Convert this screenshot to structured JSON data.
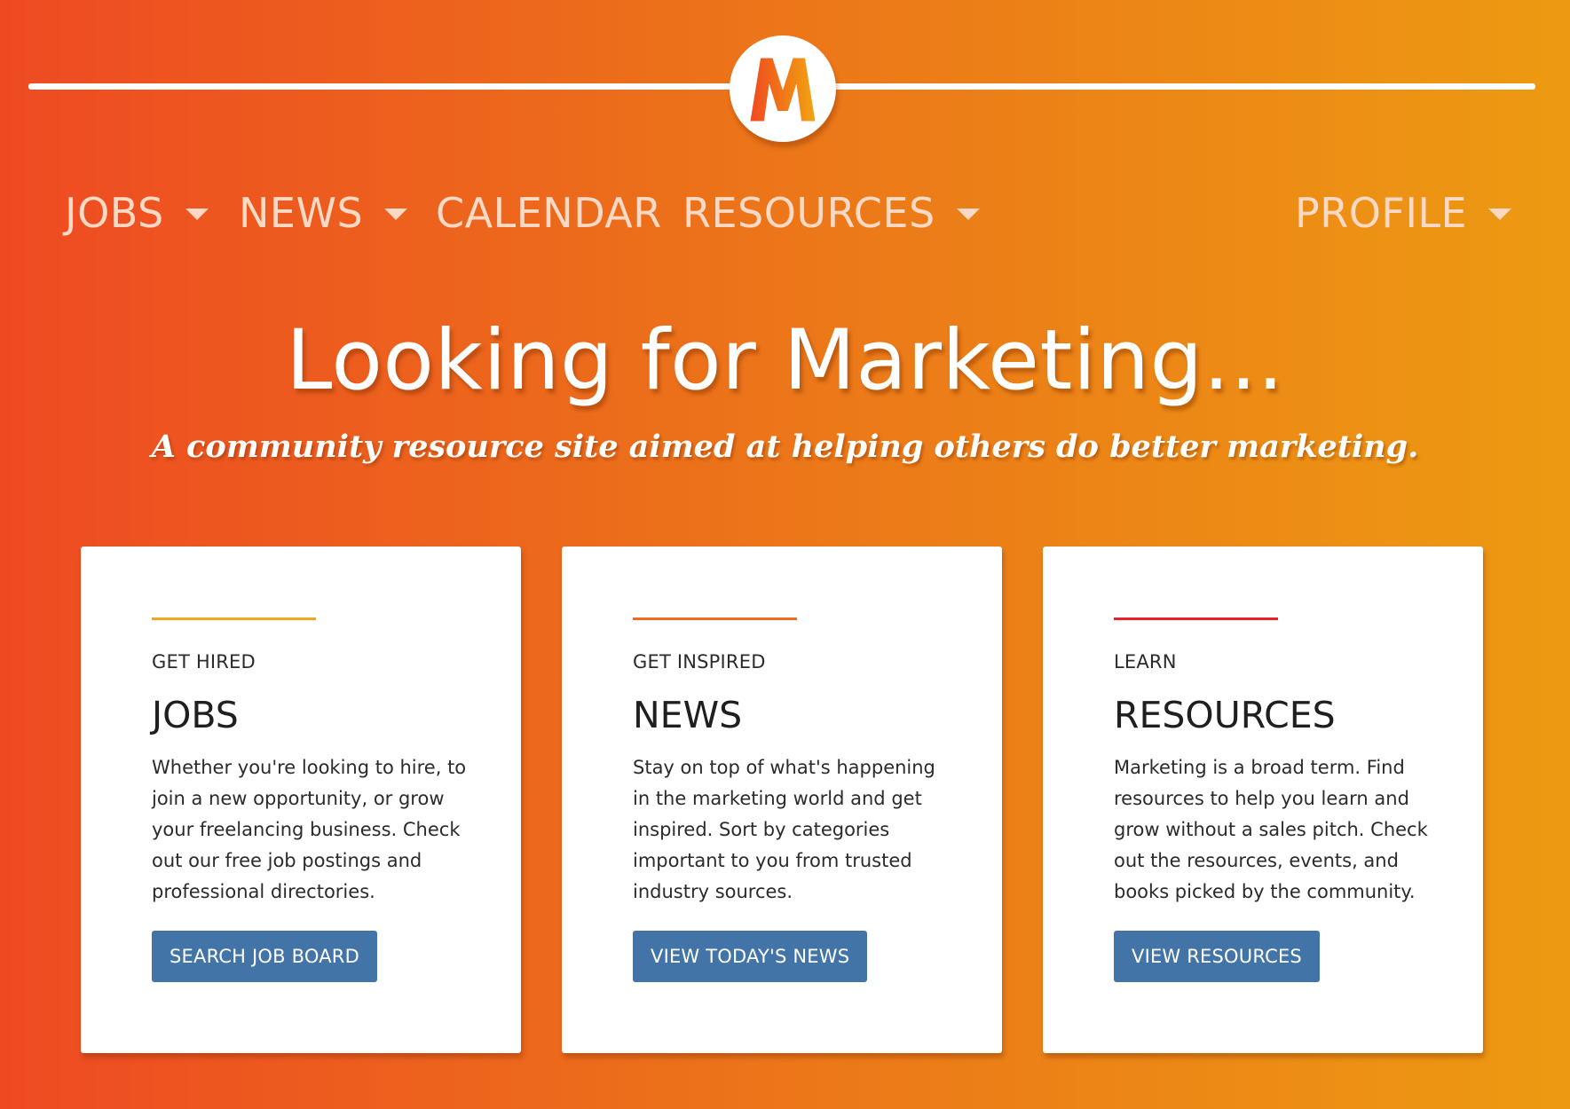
{
  "logo": {
    "letter": "M"
  },
  "nav": {
    "items": [
      {
        "label": "JOBS",
        "has_dropdown": true
      },
      {
        "label": "NEWS",
        "has_dropdown": true
      },
      {
        "label": "CALENDAR",
        "has_dropdown": false
      },
      {
        "label": "RESOURCES",
        "has_dropdown": true
      },
      {
        "label": "PROFILE",
        "has_dropdown": true
      }
    ]
  },
  "hero": {
    "title": "Looking for Marketing...",
    "subtitle": "A community resource site aimed at helping others do better marketing."
  },
  "cards": [
    {
      "eyebrow": "GET HIRED",
      "title": "JOBS",
      "text": "Whether you're looking to hire, to join a new opportunity, or grow your freelancing business. Check out our free job postings and professional directories.",
      "button": "SEARCH JOB BOARD",
      "accent_color": "#f0a916"
    },
    {
      "eyebrow": "GET INSPIRED",
      "title": "NEWS",
      "text": "Stay on top of what's happening in the marketing world and get inspired. Sort by categories important to you from trusted industry sources.",
      "button": "VIEW TODAY'S NEWS",
      "accent_color": "#f06a23"
    },
    {
      "eyebrow": "LEARN",
      "title": "RESOURCES",
      "text": "Marketing is a broad term. Find resources to help you learn and grow without a sales pitch. Check out the resources, events, and books picked by the community.",
      "button": "VIEW RESOURCES",
      "accent_color": "#e8212b"
    }
  ],
  "colors": {
    "gradient_start": "#ee4a22",
    "gradient_end": "#ed9a12",
    "button": "#4274a8",
    "nav_text": "#fcd9c4"
  },
  "icons": {
    "dropdown": "caret-down-icon",
    "logo": "m-logo-icon"
  }
}
